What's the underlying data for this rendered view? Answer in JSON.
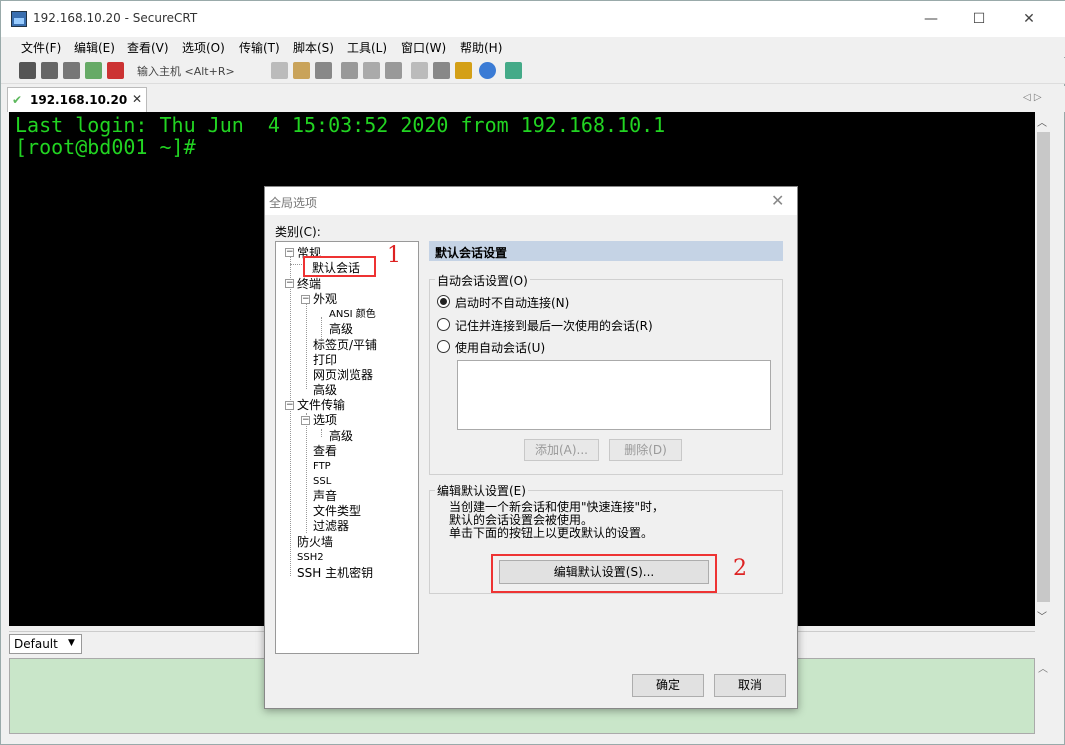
{
  "window": {
    "title": "192.168.10.20 - SecureCRT",
    "controls": {
      "minimize": "—",
      "maximize": "☐",
      "close": "✕"
    }
  },
  "menu": [
    "文件(F)",
    "编辑(E)",
    "查看(V)",
    "选项(O)",
    "传输(T)",
    "脚本(S)",
    "工具(L)",
    "窗口(W)",
    "帮助(H)"
  ],
  "toolbar": {
    "quick_connect_text": "输入主机 <Alt+R>"
  },
  "tab": {
    "label": "192.168.10.20",
    "close": "✕",
    "nav": "◁ ▷"
  },
  "terminal": {
    "lines": [
      "Last login: Thu Jun  4 15:03:52 2020 from 192.168.10.1",
      "[root@bd001 ~]#"
    ]
  },
  "statusbar": {
    "session": "Default"
  },
  "dialog": {
    "title": "全局选项",
    "category_label": "类别(C):",
    "tree": {
      "general": "常规",
      "default_session": "默认会话",
      "terminal": "终端",
      "appearance": "外观",
      "ansi_color": "ANSI 颜色",
      "advanced1": "高级",
      "tabs": "标签页/平铺",
      "print": "打印",
      "browser": "网页浏览器",
      "advanced2": "高级",
      "file_transfer": "文件传输",
      "options": "选项",
      "advanced3": "高级",
      "view": "查看",
      "ftp": "FTP",
      "ssl": "SSL",
      "sound": "声音",
      "file_types": "文件类型",
      "filters": "过滤器",
      "firewall": "防火墙",
      "ssh2": "SSH2",
      "ssh_hostkeys": "SSH 主机密钥"
    },
    "annotations": {
      "one": "1",
      "two": "2"
    },
    "panel_title": "默认会话设置",
    "auto_group": {
      "label": "自动会话设置(O)",
      "options": [
        "启动时不自动连接(N)",
        "记住并连接到最后一次使用的会话(R)",
        "使用自动会话(U)"
      ],
      "selected": 0,
      "add_button": "添加(A)...",
      "delete_button": "删除(D)"
    },
    "edit_group": {
      "label": "编辑默认设置(E)",
      "lines": [
        "当创建一个新会话和使用\"快速连接\"时，",
        "默认的会话设置会被使用。",
        "单击下面的按钮上以更改默认的设置。"
      ],
      "edit_button": "编辑默认设置(S)..."
    },
    "ok_button": "确定",
    "cancel_button": "取消"
  }
}
